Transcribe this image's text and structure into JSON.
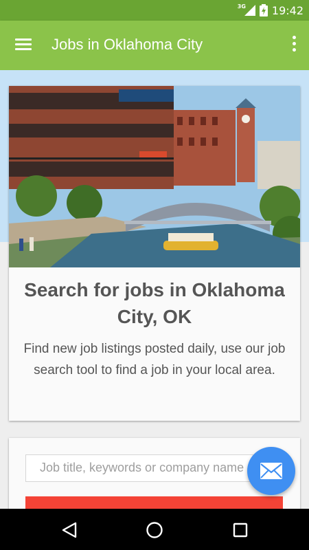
{
  "status_bar": {
    "network": "3G",
    "time": "19:42"
  },
  "app_bar": {
    "title": "Jobs in Oklahoma City",
    "menu_icon": "hamburger-menu-icon",
    "overflow_icon": "more-vert-icon"
  },
  "colors": {
    "status_bar": "#6aa533",
    "app_bar": "#8bc34a",
    "fab": "#3f8ff2",
    "search_button": "#f44336"
  },
  "hero_card": {
    "heading": "Search for jobs in Oklahoma City, OK",
    "description": "Find new job listings posted daily, use our job search tool to find a job in your local area."
  },
  "search": {
    "placeholder": "Job title, keywords or company name"
  },
  "fab": {
    "icon": "mail-icon"
  },
  "nav_bar": {
    "back_icon": "back-triangle-icon",
    "home_icon": "home-circle-icon",
    "recents_icon": "recents-square-icon"
  }
}
